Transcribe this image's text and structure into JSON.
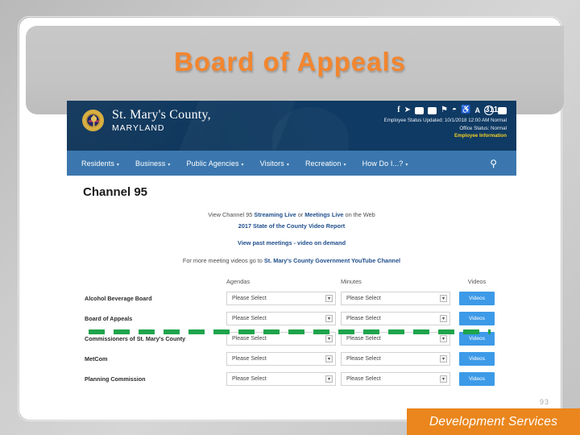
{
  "slide": {
    "title": "Board of Appeals",
    "page_number": "93",
    "footer_label": "Development Services",
    "title_color": "#f2862f",
    "footer_color": "#ea861d"
  },
  "site": {
    "brand": {
      "line1": "St. Mary's County,",
      "line2": "MARYLAND",
      "seal_icon": "county-seal-icon"
    },
    "social_icons": [
      {
        "name": "facebook-icon",
        "glyph": "f"
      },
      {
        "name": "twitter-icon",
        "glyph": "⚑"
      },
      {
        "name": "youtube-icon",
        "glyph": "▶"
      },
      {
        "name": "flickr-icon",
        "glyph": "••"
      },
      {
        "name": "flag-icon",
        "glyph": "⚑"
      },
      {
        "name": "rss-icon",
        "glyph": "◔"
      },
      {
        "name": "accessibility-icon",
        "glyph": "♿"
      },
      {
        "name": "text-size-icon",
        "glyph": "A"
      },
      {
        "name": "311-icon",
        "glyph": "311"
      },
      {
        "name": "jobs-briefcase-icon",
        "glyph": "▬"
      }
    ],
    "status": {
      "employee_status": "Employee Status Updated: 10/1/2018 12:00 AM Normal",
      "office_status": "Office Status: Normal",
      "employee_link": "Employee Information",
      "link_color": "#f2d024"
    },
    "nav": {
      "items": [
        {
          "label": "Residents",
          "caret": "▾"
        },
        {
          "label": "Business",
          "caret": "▾"
        },
        {
          "label": "Public Agencies",
          "caret": "▾"
        },
        {
          "label": "Visitors",
          "caret": "▾"
        },
        {
          "label": "Recreation",
          "caret": "▾"
        },
        {
          "label": "How Do I...?",
          "caret": "▾"
        }
      ],
      "search_icon": "⚲"
    },
    "page": {
      "heading": "Channel 95",
      "line1_pre": "View Channel 95 ",
      "line1_link1": "Streaming Live",
      "line1_mid": " or ",
      "line1_link2": "Meetings Live",
      "line1_post": " on the Web",
      "line2": "2017 State of the County Video Report",
      "line3": "View past meetings - video on demand",
      "line4_pre": "For more meeting videos go to ",
      "line4_link": "St. Mary's County Government YouTube Channel"
    },
    "table": {
      "headers": {
        "spacer": "",
        "agendas": "Agendas",
        "minutes": "Minutes",
        "videos": "Videos"
      },
      "select_placeholder": "Please Select",
      "select_arrow": "▾",
      "video_button_label": "Videos",
      "rows": [
        {
          "label": "Alcohol Beverage Board"
        },
        {
          "label": "Board of Appeals"
        },
        {
          "label": "Commissioners of St. Mary's County"
        },
        {
          "label": "MetCom"
        },
        {
          "label": "Planning Commission"
        }
      ]
    },
    "annotation": {
      "type": "green-dashed-underline",
      "color": "#1fa44c",
      "target_row": "Board of Appeals"
    }
  }
}
